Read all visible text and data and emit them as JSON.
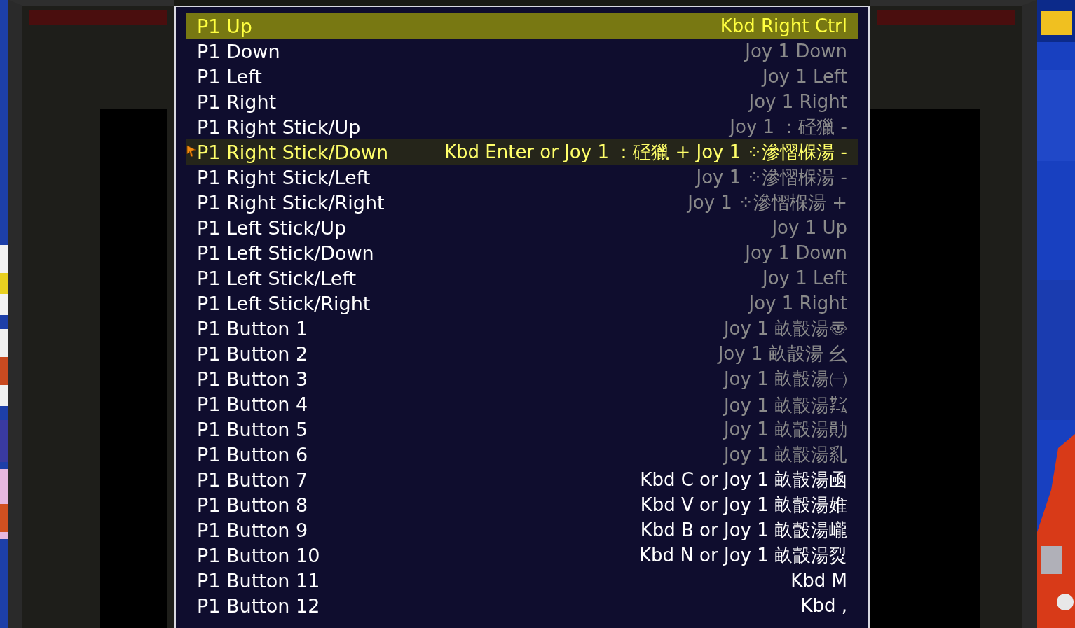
{
  "menu": {
    "rows": [
      {
        "name": "P1 Up",
        "binding": "Kbd Right Ctrl",
        "selected": true,
        "hovered": false,
        "modified": true
      },
      {
        "name": "P1 Down",
        "binding": "Joy 1 Down",
        "selected": false,
        "hovered": false,
        "modified": false
      },
      {
        "name": "P1 Left",
        "binding": "Joy 1 Left",
        "selected": false,
        "hovered": false,
        "modified": false
      },
      {
        "name": "P1 Right",
        "binding": "Joy 1 Right",
        "selected": false,
        "hovered": false,
        "modified": false
      },
      {
        "name": "P1 Right Stick/Up",
        "binding": "Joy 1 ：硁獵 -",
        "selected": false,
        "hovered": false,
        "modified": false
      },
      {
        "name": "P1 Right Stick/Down",
        "binding": "Kbd Enter or Joy 1 ：硁獵 + Joy 1 ⁘滲慴椺湯 -",
        "selected": false,
        "hovered": true,
        "modified": true
      },
      {
        "name": "P1 Right Stick/Left",
        "binding": "Joy 1 ⁘滲慴椺湯 -",
        "selected": false,
        "hovered": false,
        "modified": false
      },
      {
        "name": "P1 Right Stick/Right",
        "binding": "Joy 1 ⁘滲慴椺湯 +",
        "selected": false,
        "hovered": false,
        "modified": false
      },
      {
        "name": "P1 Left Stick/Up",
        "binding": "Joy 1 Up",
        "selected": false,
        "hovered": false,
        "modified": false
      },
      {
        "name": "P1 Left Stick/Down",
        "binding": "Joy 1 Down",
        "selected": false,
        "hovered": false,
        "modified": false
      },
      {
        "name": "P1 Left Stick/Left",
        "binding": "Joy 1 Left",
        "selected": false,
        "hovered": false,
        "modified": false
      },
      {
        "name": "P1 Left Stick/Right",
        "binding": "Joy 1 Right",
        "selected": false,
        "hovered": false,
        "modified": false
      },
      {
        "name": "P1 Button 1",
        "binding": "Joy 1 畝瞉湯〠",
        "selected": false,
        "hovered": false,
        "modified": false
      },
      {
        "name": "P1 Button 2",
        "binding": "Joy 1 畝瞉湯 幺",
        "selected": false,
        "hovered": false,
        "modified": false
      },
      {
        "name": "P1 Button 3",
        "binding": "Joy 1 畝瞉湯㈠",
        "selected": false,
        "hovered": false,
        "modified": false
      },
      {
        "name": "P1 Button 4",
        "binding": "Joy 1 畝瞉湯㌠",
        "selected": false,
        "hovered": false,
        "modified": false
      },
      {
        "name": "P1 Button 5",
        "binding": "Joy 1 畝瞉湯勛",
        "selected": false,
        "hovered": false,
        "modified": false
      },
      {
        "name": "P1 Button 6",
        "binding": "Joy 1 畝瞉湯乿",
        "selected": false,
        "hovered": false,
        "modified": false
      },
      {
        "name": "P1 Button 7",
        "binding": "Kbd C or Joy 1 畝瞉湯凾",
        "selected": false,
        "hovered": false,
        "modified": true
      },
      {
        "name": "P1 Button 8",
        "binding": "Kbd V or Joy 1 畝瞉湯婎",
        "selected": false,
        "hovered": false,
        "modified": true
      },
      {
        "name": "P1 Button 9",
        "binding": "Kbd B or Joy 1 畝瞉湯巄",
        "selected": false,
        "hovered": false,
        "modified": true
      },
      {
        "name": "P1 Button 10",
        "binding": "Kbd N or Joy 1 畝瞉湯烮",
        "selected": false,
        "hovered": false,
        "modified": true
      },
      {
        "name": "P1 Button 11",
        "binding": "Kbd M",
        "selected": false,
        "hovered": false,
        "modified": true
      },
      {
        "name": "P1 Button 12",
        "binding": "Kbd ,",
        "selected": false,
        "hovered": false,
        "modified": true
      }
    ]
  }
}
